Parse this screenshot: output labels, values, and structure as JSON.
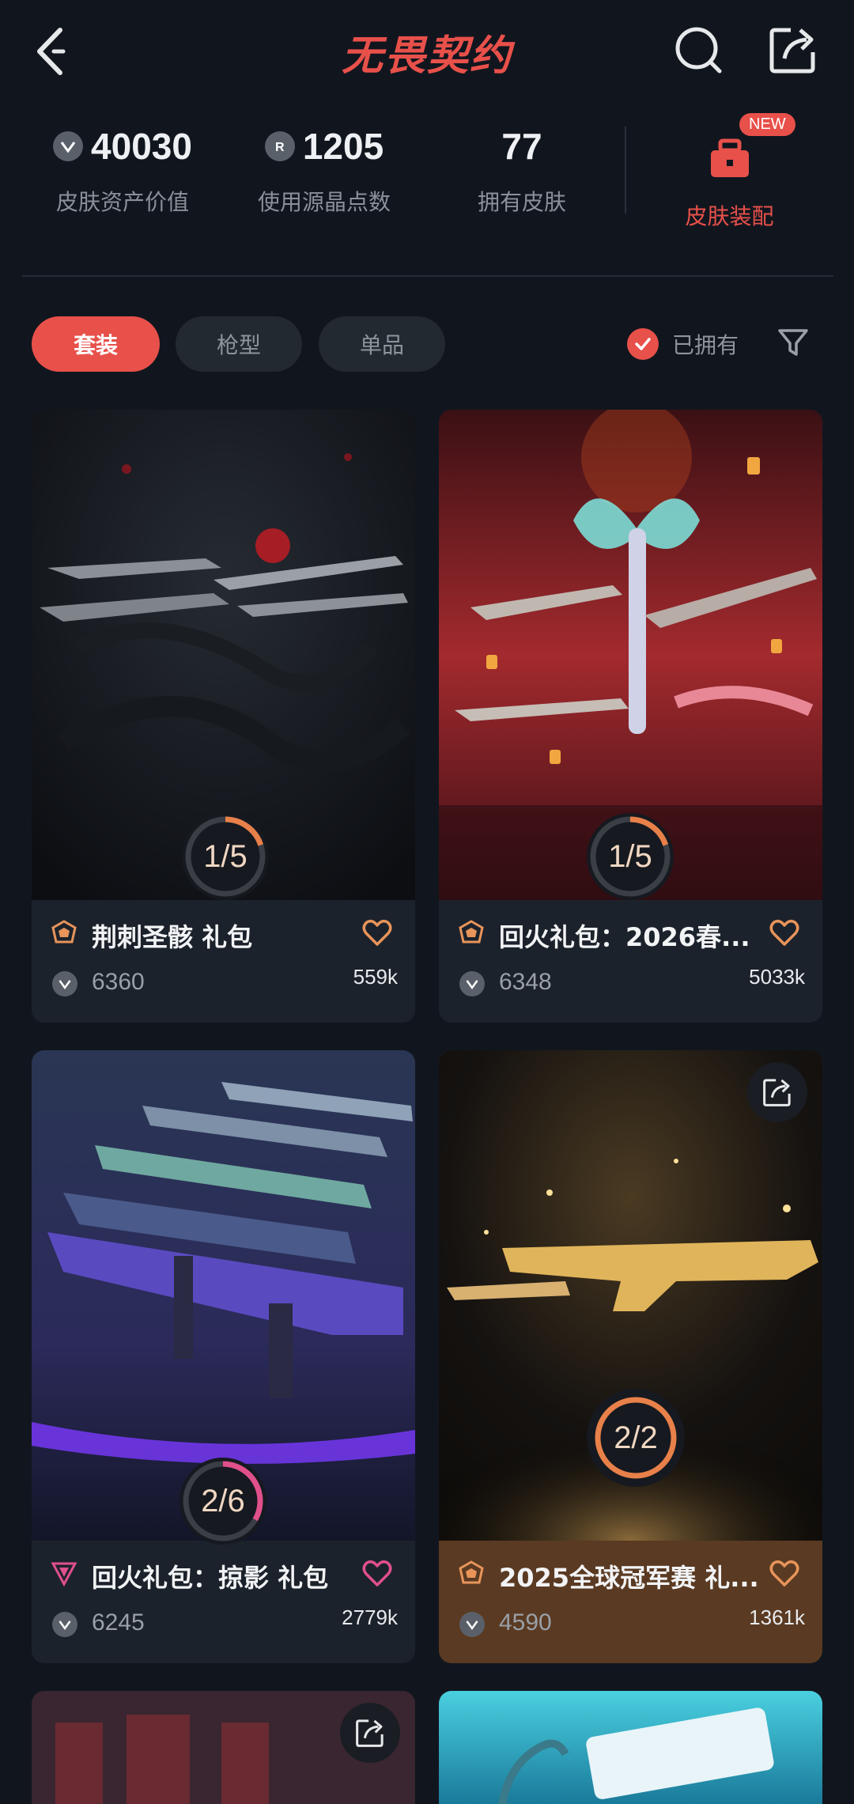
{
  "header": {
    "title": "无畏契约",
    "back_icon": "back-chevron-icon",
    "search_icon": "search-icon",
    "share_icon": "share-icon"
  },
  "stats": {
    "asset_value": "40030",
    "asset_label": "皮肤资产价值",
    "points": "1205",
    "points_label": "使用源晶点数",
    "skins_owned": "77",
    "skins_label": "拥有皮肤",
    "equip_label": "皮肤装配",
    "new_badge": "NEW"
  },
  "tabs": [
    {
      "label": "套装",
      "active": true
    },
    {
      "label": "枪型",
      "active": false
    },
    {
      "label": "单品",
      "active": false
    }
  ],
  "filter": {
    "owned_label": "已拥有",
    "owned_checked": true
  },
  "colors": {
    "accent": "#e8504a",
    "bg": "#11161e",
    "card": "#1c222b",
    "gold_card": "#5a3a22"
  },
  "cards": [
    {
      "name": "荆刺圣骸 礼包",
      "price": "6360",
      "likes": "559k",
      "progress": "1/5",
      "owned": 1,
      "total": 5
    },
    {
      "name": "回火礼包：2026春...",
      "price": "6348",
      "likes": "5033k",
      "progress": "1/5",
      "owned": 1,
      "total": 5
    },
    {
      "name": "回火礼包：掠影 礼包",
      "price": "6245",
      "likes": "2779k",
      "progress": "2/6",
      "owned": 2,
      "total": 6
    },
    {
      "name": "2025全球冠军赛 礼...",
      "price": "4590",
      "likes": "1361k",
      "progress": "2/2",
      "owned": 2,
      "total": 2
    }
  ]
}
